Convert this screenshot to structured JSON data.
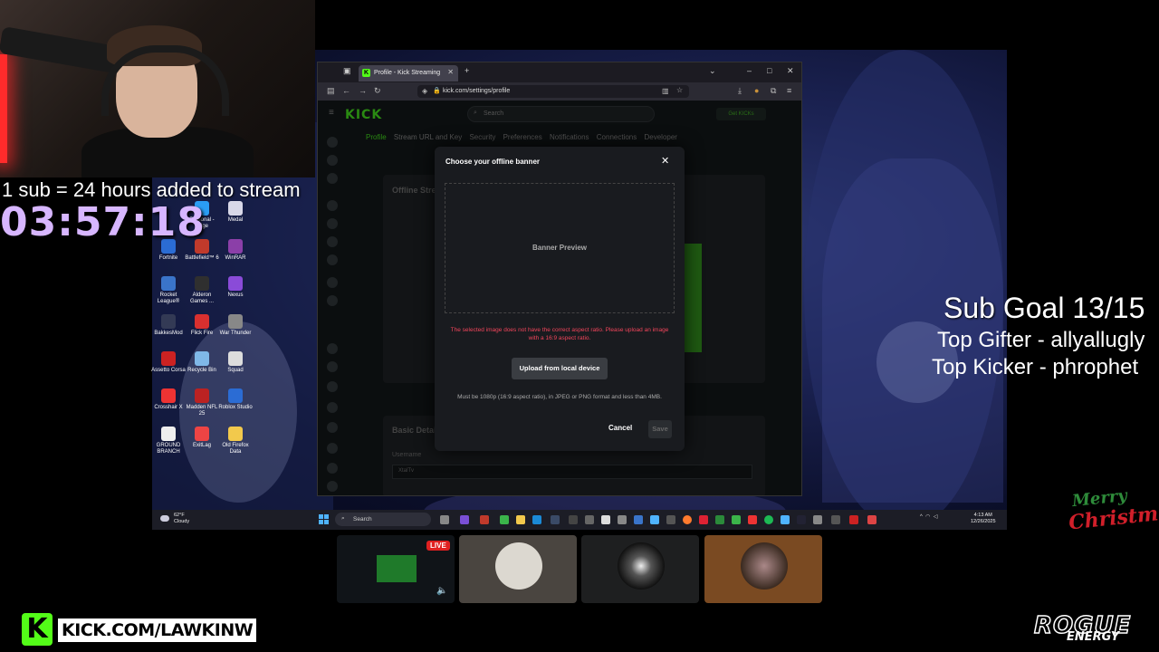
{
  "overlay": {
    "sub_rule": "1 sub = 24 hours added to stream",
    "timer": "03:57:18",
    "sub_goal": "Sub Goal 13/15",
    "top_gifter": "Top Gifter - allyallugly",
    "top_kicker": "Top Kicker - phrophet",
    "merry": "Merry",
    "christmas": "Christmas",
    "kick_url": "KICK.COM/LAWKINW",
    "kick_badge": "K",
    "sponsor": "ROGUE",
    "sponsor_sub": "ENERGY",
    "live_badge": "LIVE"
  },
  "desktop_icons": [
    {
      "label": "Personal - Edge",
      "color": "#2a9df4"
    },
    {
      "label": "Medal",
      "color": "#d8d8e8"
    },
    {
      "label": "Fortnite",
      "color": "#2b6cd4"
    },
    {
      "label": "Battlefield™ 6",
      "color": "#c03a2b"
    },
    {
      "label": "WinRAR",
      "color": "#8b3fa8"
    },
    {
      "label": "Rocket League®",
      "color": "#3a74c9"
    },
    {
      "label": "Alderon Games ...",
      "color": "#2f2f2f"
    },
    {
      "label": "Nexus",
      "color": "#8a4bd8"
    },
    {
      "label": "BakkesMod",
      "color": "#333a55"
    },
    {
      "label": "Flick Fire",
      "color": "#d9302f"
    },
    {
      "label": "War Thunder",
      "color": "#888"
    },
    {
      "label": "Assetto Corsa",
      "color": "#c22"
    },
    {
      "label": "Recycle Bin",
      "color": "#7fb8e8"
    },
    {
      "label": "Squad",
      "color": "#ddd"
    },
    {
      "label": "Crosshair X",
      "color": "#e33"
    },
    {
      "label": "Madden NFL 25",
      "color": "#b22"
    },
    {
      "label": "Roblox Studio",
      "color": "#2b6cd4"
    },
    {
      "label": "GROUND BRANCH",
      "color": "#eee"
    },
    {
      "label": "ExitLag",
      "color": "#e44"
    },
    {
      "label": "Old Firefox Data",
      "color": "#f2c94c"
    }
  ],
  "browser": {
    "tab_title": "Profile - Kick Streaming",
    "url": "kick.com/settings/profile",
    "icons": {
      "back": "back-arrow-icon",
      "forward": "forward-arrow-icon",
      "reload": "reload-icon"
    }
  },
  "kick": {
    "logo": "KICK",
    "search_placeholder": "Search",
    "get_kicks": "Get KICKs",
    "tabs": [
      "Profile",
      "Stream URL and Key",
      "Security",
      "Preferences",
      "Notifications",
      "Connections",
      "Developer"
    ],
    "offline_title": "Offline Stream",
    "basic_title": "Basic Details",
    "username_label": "Username",
    "username_value": "XtalTv"
  },
  "modal": {
    "title": "Choose your offline banner",
    "preview_label": "Banner Preview",
    "error": "The selected image does not have the correct aspect ratio. Please upload an image with a 16:9 aspect ratio.",
    "upload_label": "Upload from local device",
    "hint": "Must be 1080p (16:9 aspect ratio), in JPEG or PNG format and less than 4MB.",
    "cancel_label": "Cancel",
    "save_label": "Save"
  },
  "taskbar": {
    "weather_temp": "62°F",
    "weather_desc": "Cloudy",
    "search_placeholder": "Search",
    "time": "4:13 AM",
    "date": "12/26/2025"
  }
}
